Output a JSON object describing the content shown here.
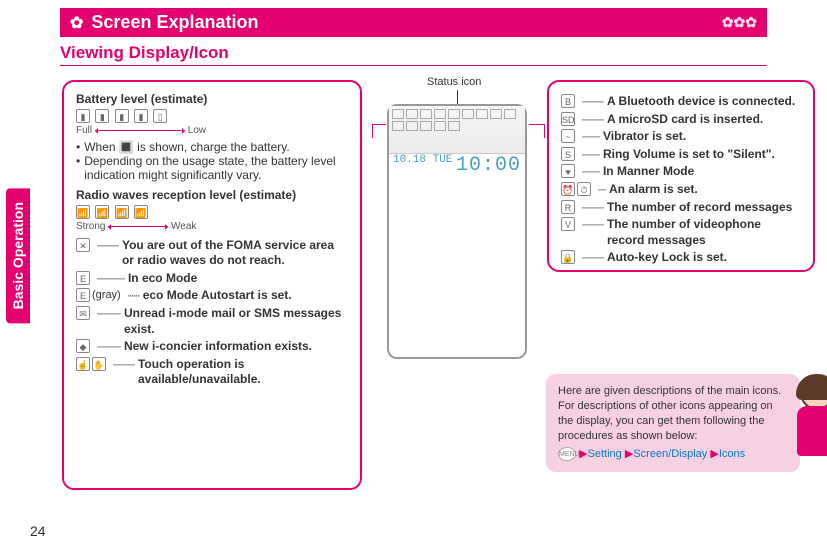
{
  "header": {
    "title": "Screen Explanation",
    "subtitle": "Viewing Display/Icon"
  },
  "side_tab": "Basic Operation",
  "page_number": "24",
  "status_icon_label": "Status icon",
  "phone": {
    "date": "10.18 TUE",
    "time": "10:00"
  },
  "left_box": {
    "battery_heading": "Battery level (estimate)",
    "battery_full": "Full",
    "battery_low": "Low",
    "bullets": [
      "When 🔳 is shown, charge the battery.",
      "Depending on the usage state, the battery level indication might significantly vary."
    ],
    "radio_heading": "Radio waves reception level (estimate)",
    "radio_strong": "Strong",
    "radio_weak": "Weak",
    "entries": [
      {
        "label": "You are out of the FOMA service area or radio waves do not reach."
      },
      {
        "label": "In eco Mode"
      },
      {
        "prefix": "(gray)",
        "label": "eco Mode Autostart is set."
      },
      {
        "label": "Unread i-mode mail or SMS messages exist."
      },
      {
        "label": "New i-concier information exists."
      },
      {
        "label": "Touch operation is available/unavailable."
      }
    ]
  },
  "right_box": {
    "entries": [
      "A Bluetooth device is connected.",
      "A microSD card is inserted.",
      "Vibrator is set.",
      "Ring Volume is set to \"Silent\".",
      "In Manner Mode",
      "An alarm is set.",
      "The number of record messages",
      "The number of videophone record messages",
      "Auto-key Lock is set."
    ]
  },
  "speech": {
    "intro": "Here are given descriptions of the main icons. For descriptions of other icons appearing on the display, you can get them following the procedures as shown below:",
    "menu_label": "MENU",
    "nav": [
      "Setting",
      "Screen/Display",
      "Icons"
    ]
  }
}
